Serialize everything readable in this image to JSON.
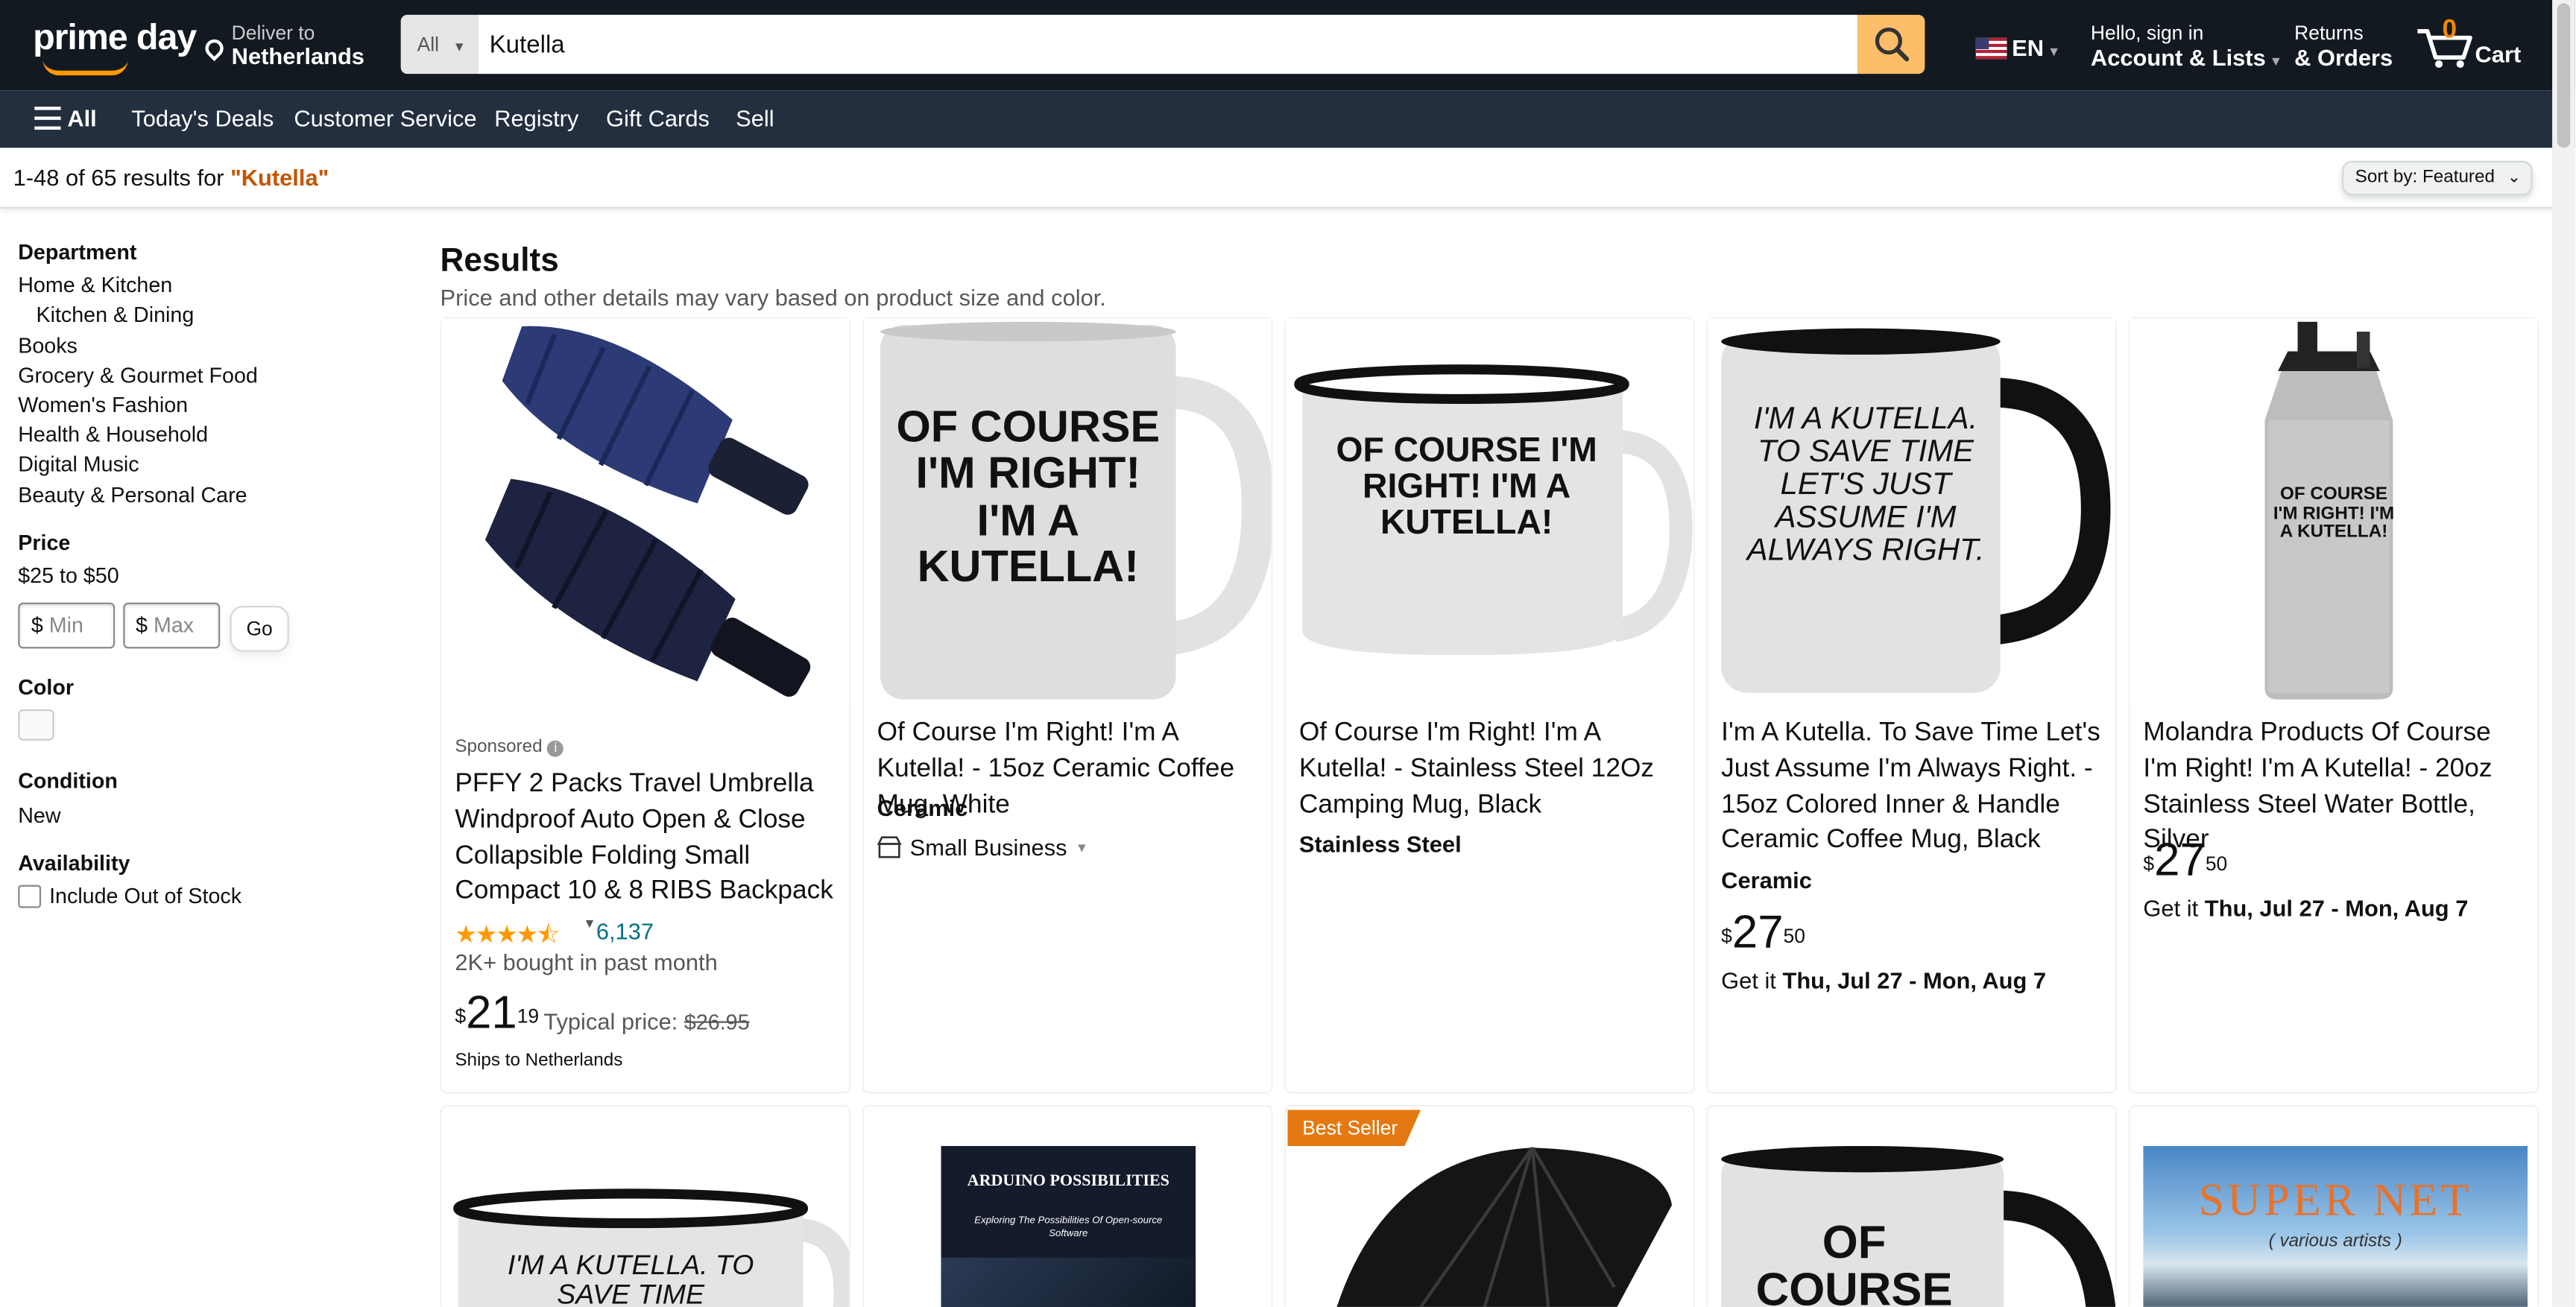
{
  "nav": {
    "logo_text": "prime day",
    "deliver_label": "Deliver to",
    "deliver_location": "Netherlands",
    "search_category": "All",
    "search_value": "Kutella",
    "language": "EN",
    "account_greeting": "Hello, sign in",
    "account_label": "Account & Lists",
    "returns_label": "Returns",
    "orders_label": "& Orders",
    "cart_count": "0",
    "cart_label": "Cart"
  },
  "subnav": {
    "menu_label": "All",
    "links": [
      "Today's Deals",
      "Customer Service",
      "Registry",
      "Gift Cards",
      "Sell"
    ]
  },
  "results_bar": {
    "count_text": "1-48 of 65 results for ",
    "query": "\"Kutella\"",
    "sort_label": "Sort by:",
    "sort_value": "Featured"
  },
  "sidebar": {
    "department_heading": "Department",
    "departments": [
      "Home & Kitchen",
      "Kitchen & Dining",
      "Books",
      "Grocery & Gourmet Food",
      "Women's Fashion",
      "Health & Household",
      "Digital Music",
      "Beauty & Personal Care"
    ],
    "price_heading": "Price",
    "price_range": "$25 to $50",
    "min_currency": "$",
    "min_placeholder": "Min",
    "max_currency": "$",
    "max_placeholder": "Max",
    "go_label": "Go",
    "color_heading": "Color",
    "condition_heading": "Condition",
    "condition_value": "New",
    "availability_heading": "Availability",
    "availability_option": "Include Out of Stock"
  },
  "results": {
    "heading": "Results",
    "subheading": "Price and other details may vary based on product size and color."
  },
  "products": [
    {
      "sponsored": "Sponsored",
      "title": "PFFY 2 Packs Travel Umbrella Windproof Auto Open & Close Collapsible Folding Small Compact 10 & 8 RIBS Backpack Car travel...",
      "rating_count": "6,137",
      "bought": "2K+ bought in past month",
      "price_whole": "21",
      "price_fraction": "19",
      "price_symbol": "$",
      "typical_label": "Typical price:",
      "typical_price": "$26.95",
      "shipping": "Ships to Netherlands"
    },
    {
      "title": "Of Course I'm Right! I'm A Kutella! - 15oz Ceramic Coffee Mug, White",
      "material": "Ceramic",
      "badge": "Small Business",
      "image_text": "OF COURSE I'M RIGHT! I'M A KUTELLA!"
    },
    {
      "title": "Of Course I'm Right! I'm A Kutella! - Stainless Steel 12Oz Camping Mug, Black",
      "material": "Stainless Steel",
      "image_text": "OF COURSE I'M RIGHT! I'M A KUTELLA!"
    },
    {
      "title": "I'm A Kutella. To Save Time Let's Just Assume I'm Always Right. - 15oz Colored Inner & Handle Ceramic Coffee Mug, Black",
      "material": "Ceramic",
      "price_symbol": "$",
      "price_whole": "27",
      "price_fraction": "50",
      "delivery_prefix": "Get it ",
      "delivery_dates": "Thu, Jul 27 - Mon, Aug 7",
      "image_text": "I'M A KUTELLA. TO SAVE TIME LET'S JUST ASSUME I'M ALWAYS RIGHT."
    },
    {
      "title": "Molandra Products Of Course I'm Right! I'm A Kutella! - 20oz Stainless Steel Water Bottle, Silver",
      "price_symbol": "$",
      "price_whole": "27",
      "price_fraction": "50",
      "delivery_prefix": "Get it ",
      "delivery_dates": "Thu, Jul 27 - Mon, Aug 7",
      "image_text": "OF COURSE I'M RIGHT! I'M A KUTELLA!"
    }
  ],
  "row2": {
    "card1_image_text": "I'M A KUTELLA. TO SAVE TIME",
    "card2_book_title": "ARDUINO POSSIBILITIES",
    "card2_book_subtitle": "Exploring The Possibilities Of Open-source Software",
    "card3_badge": "Best Seller",
    "card4_image_text": "OF COURSE I'M RIGHT!",
    "card5_album_title": "SUPER NET",
    "card5_album_subtitle": "( various artists )"
  },
  "colors": {
    "nav_bg": "#131921",
    "subnav_bg": "#232f3e",
    "search_button": "#febd69",
    "query_orange": "#c45500",
    "link": "#007185",
    "best_seller": "#e47911"
  }
}
